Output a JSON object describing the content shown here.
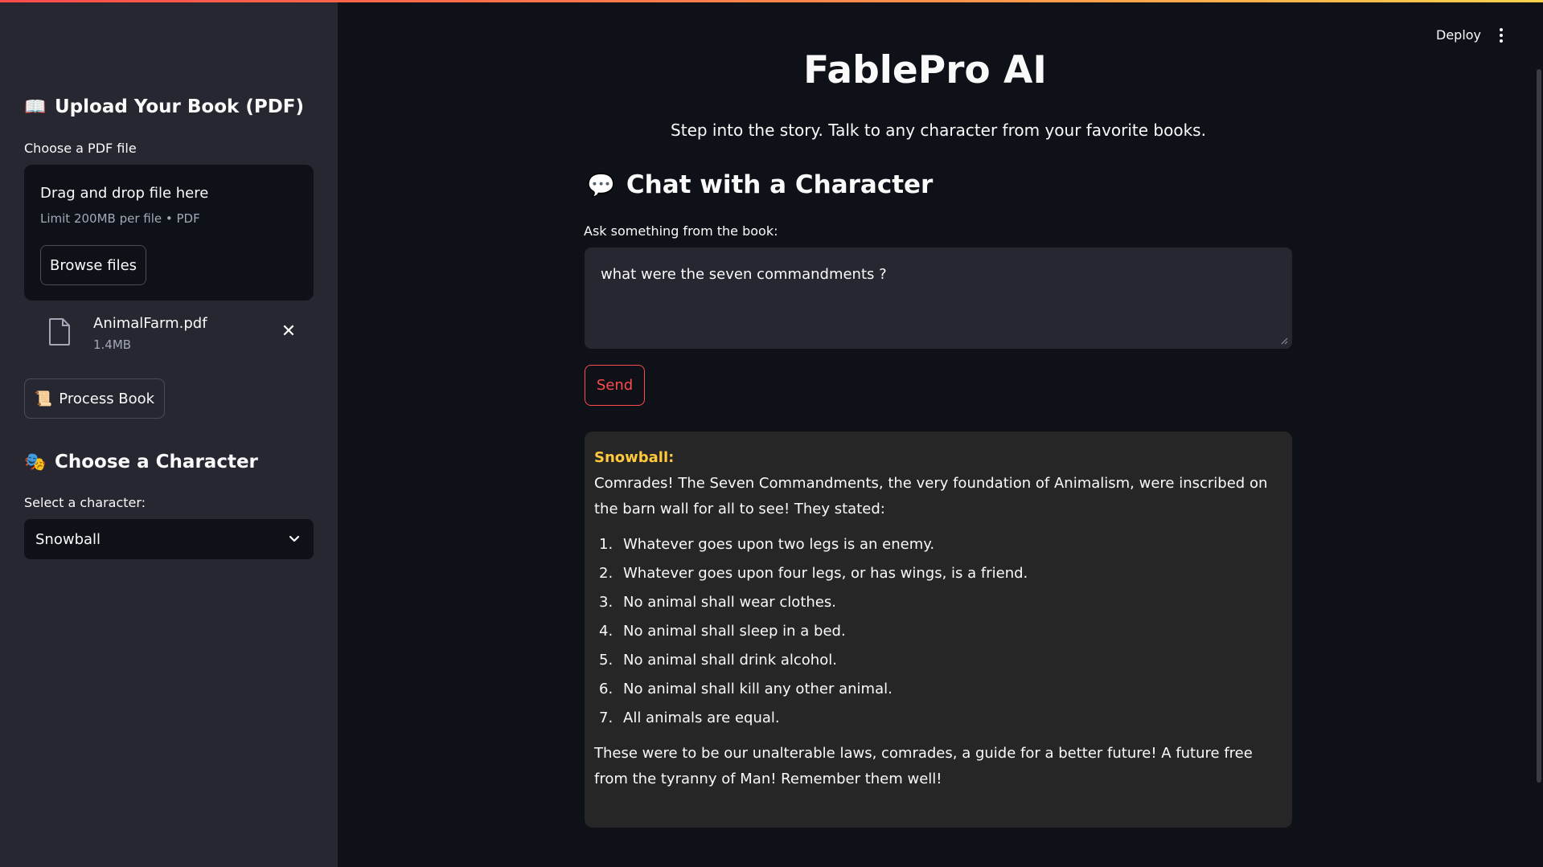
{
  "sidebar": {
    "upload_heading": "Upload Your Book (PDF)",
    "upload_emoji": "📖",
    "choose_label": "Choose a PDF file",
    "dropzone": {
      "title": "Drag and drop file here",
      "limit": "Limit 200MB per file • PDF",
      "browse_label": "Browse files"
    },
    "file": {
      "name": "AnimalFarm.pdf",
      "size": "1.4MB",
      "icon": "file-icon",
      "close_icon": "close-icon"
    },
    "process_label": "Process Book",
    "process_emoji": "📜",
    "character_heading": "Choose a Character",
    "character_emoji": "🎭",
    "select_label": "Select a character:",
    "selected_character": "Snowball"
  },
  "header": {
    "deploy_label": "Deploy"
  },
  "main": {
    "title": "FablePro AI",
    "subtitle": "Step into the story. Talk to any character from your favorite books.",
    "chat_heading": "Chat with a Character",
    "chat_emoji": "💬",
    "ask_label": "Ask something from the book:",
    "question_value": "what were the seven commandments ?",
    "send_label": "Send",
    "response": {
      "speaker": "Snowball:",
      "intro": "Comrades! The Seven Commandments, the very foundation of Animalism, were inscribed on the barn wall for all to see! They stated:",
      "items": [
        {
          "num": "1.",
          "text": "Whatever goes upon two legs is an enemy."
        },
        {
          "num": "2.",
          "text": "Whatever goes upon four legs, or has wings, is a friend."
        },
        {
          "num": "3.",
          "text": "No animal shall wear clothes."
        },
        {
          "num": "4.",
          "text": "No animal shall sleep in a bed."
        },
        {
          "num": "5.",
          "text": "No animal shall drink alcohol."
        },
        {
          "num": "6.",
          "text": "No animal shall kill any other animal."
        },
        {
          "num": "7.",
          "text": "All animals are equal."
        }
      ],
      "outro": "These were to be our unalterable laws, comrades, a guide for a better future! A future free from the tyranny of Man! Remember them well!"
    }
  },
  "colors": {
    "accent": "#ff4b4b",
    "speaker": "#ffc83d",
    "background": "#0e1117",
    "sidebar": "#262730"
  }
}
